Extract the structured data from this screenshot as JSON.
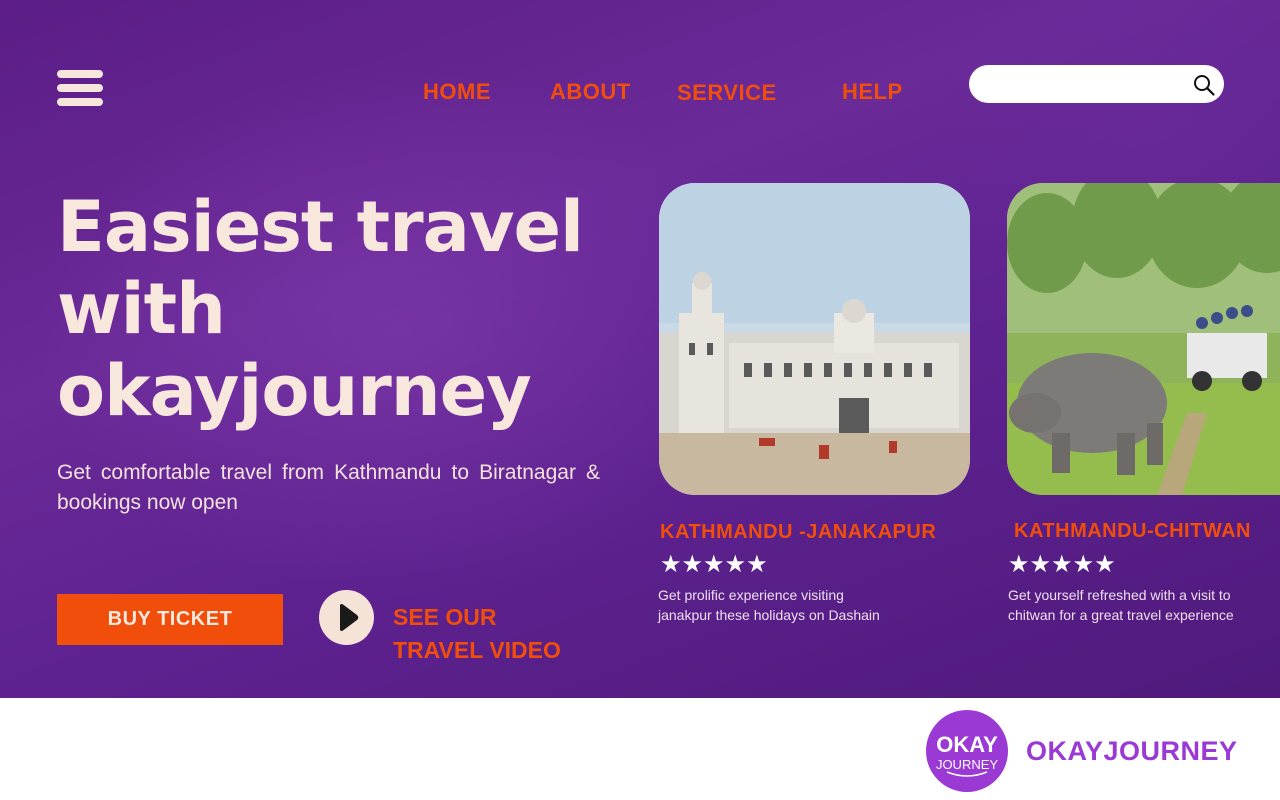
{
  "nav": {
    "home": "HOME",
    "about": "ABOUT",
    "service": "SERVICE",
    "help": "HELP"
  },
  "search": {
    "placeholder": "",
    "value": ""
  },
  "hero": {
    "headline_line1": "Easiest travel",
    "headline_line2": "with",
    "headline_line3": "okayjourney",
    "subtext": "Get comfortable travel from Kathmandu to Biratnagar & bookings now open",
    "buy_label": "BUY TICKET",
    "video_label_line1": "SEE OUR",
    "video_label_line2": "TRAVEL VIDEO"
  },
  "cards": [
    {
      "title": "KATHMANDU -JANAKAPUR",
      "stars": "★★★★★",
      "rating": 5,
      "desc_line1": "Get prolific experience visiting",
      "desc_line2": "janakpur these holidays on Dashain"
    },
    {
      "title": "KATHMANDU-CHITWAN",
      "stars": "★★★★★",
      "rating": 5,
      "desc_line1": "Get yourself refreshed with a visit to",
      "desc_line2": "chitwan for a great travel experience"
    }
  ],
  "footer": {
    "logo_text_top": "OKAY",
    "logo_text_bottom": "JOURNEY",
    "brand": "OKAYJOURNEY"
  },
  "colors": {
    "hero_bg": "#5e2290",
    "accent_orange": "#f04e0a",
    "cream": "#f8e7dc",
    "brand_purple": "#9a39d4"
  },
  "icons": [
    "hamburger-menu-icon",
    "search-icon",
    "play-icon",
    "star-icon"
  ]
}
